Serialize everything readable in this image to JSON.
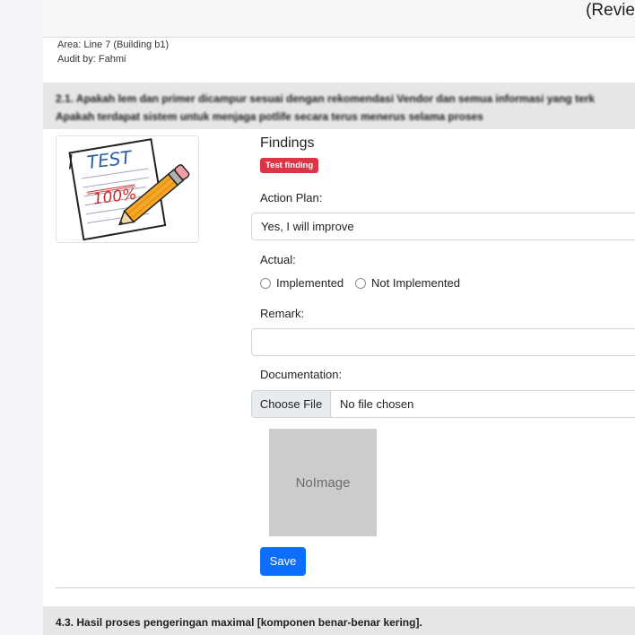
{
  "header": {
    "title": "(Revie"
  },
  "meta": {
    "area": "Area: Line 7 (Building b1)",
    "audit_by": "Audit by: Fahmi"
  },
  "question_1": {
    "line1": "2.1. Apakah lem dan primer dicampur sesuai dengan rekomendasi Vendor dan semua informasi yang terk",
    "line2": "Apakah terdapat sistem untuk menjaga potlife secara terus menerus selama proses"
  },
  "findings": {
    "title": "Findings",
    "badge": "Test finding"
  },
  "action_plan": {
    "label": "Action Plan:",
    "value": "Yes, I will improve"
  },
  "actual": {
    "label": "Actual:",
    "options": [
      "Implemented",
      "Not Implemented"
    ]
  },
  "remark": {
    "label": "Remark:",
    "value": ""
  },
  "documentation": {
    "label": "Documentation:",
    "button": "Choose File",
    "status": "No file chosen"
  },
  "noimage": {
    "text": "NoImage"
  },
  "save": {
    "label": "Save"
  },
  "question_2": {
    "text": "4.3. Hasil proses pengeringan maximal [komponen benar-benar kering]."
  },
  "colors": {
    "accent": "#0d6efd",
    "badge": "#dc3545",
    "section_bg": "#e5e6e8"
  }
}
